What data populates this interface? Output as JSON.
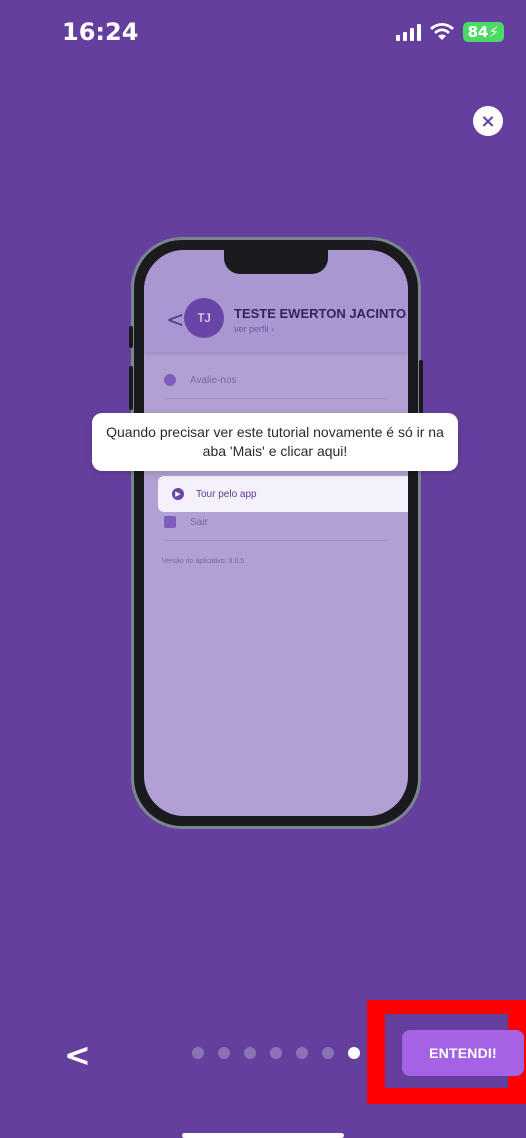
{
  "status_bar": {
    "time": "16:24",
    "battery": "84"
  },
  "close_button": {
    "label": "×"
  },
  "phone_mockup": {
    "avatar_initials": "TJ",
    "user_name": "TESTE EWERTON JACINTO",
    "profile_link": "ver perfil",
    "items": [
      {
        "label": "Avalie-nos"
      },
      {
        "label": "Tour pelo app"
      },
      {
        "label": "Sair"
      }
    ],
    "version": "Versão do aplicativo: 3.0.5"
  },
  "tooltip": {
    "text": "Quando precisar ver este tutorial novamente é só ir na aba 'Mais' e clicar aqui!"
  },
  "navigation": {
    "back_label": "<",
    "page_count": 7,
    "active_page": 7,
    "entendi_label": "ENTENDI!"
  },
  "colors": {
    "background": "#653f9e",
    "button": "#a463e5",
    "highlight": "#ff0000"
  }
}
